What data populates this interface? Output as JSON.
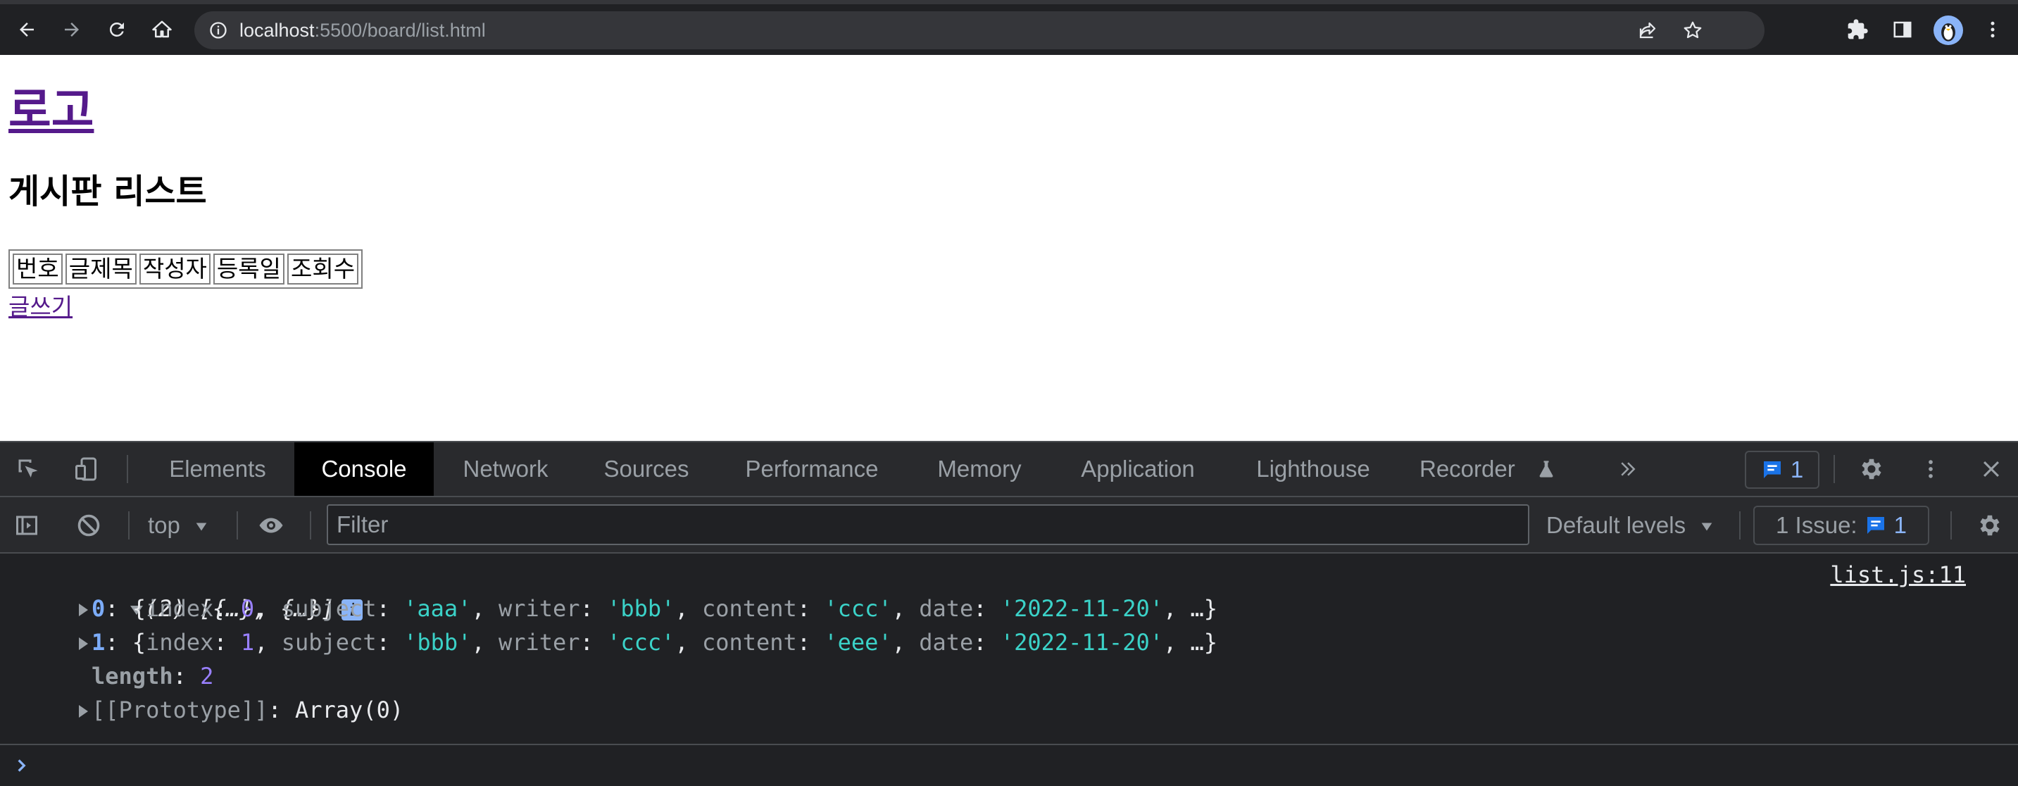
{
  "browser": {
    "url_host": "localhost",
    "url_rest": ":5500/board/list.html"
  },
  "page": {
    "logo_text": "로고",
    "board_title": "게시판 리스트",
    "table_headers": [
      "번호",
      "글제목",
      "작성자",
      "등록일",
      "조회수"
    ],
    "write_link": "글쓰기"
  },
  "devtools": {
    "tabs": [
      "Elements",
      "Console",
      "Network",
      "Sources",
      "Performance",
      "Memory",
      "Application",
      "Lighthouse",
      "Recorder"
    ],
    "active_tab": "Console",
    "issues_badge_count": "1",
    "context": "top",
    "filter_placeholder": "Filter",
    "levels": "Default levels",
    "issues_label": "1 Issue:",
    "issues_count": "1",
    "console": {
      "summary": "(2) [{…}, {…}]",
      "source": "list.js:11",
      "items": [
        {
          "idx": "0",
          "index": "0",
          "subject": "'aaa'",
          "writer": "'bbb'",
          "content": "'ccc'",
          "date": "'2022-11-20'"
        },
        {
          "idx": "1",
          "index": "1",
          "subject": "'bbb'",
          "writer": "'ccc'",
          "content": "'eee'",
          "date": "'2022-11-20'"
        }
      ],
      "length_key": "length",
      "length_value": "2",
      "prototype_key": "[[Prototype]]",
      "prototype_value": "Array(0)"
    }
  },
  "colors": {
    "chrome_bg": "#202124",
    "link_visited": "#551a8b",
    "devtools_bg": "#202124",
    "accent_blue": "#8ab4f8"
  }
}
